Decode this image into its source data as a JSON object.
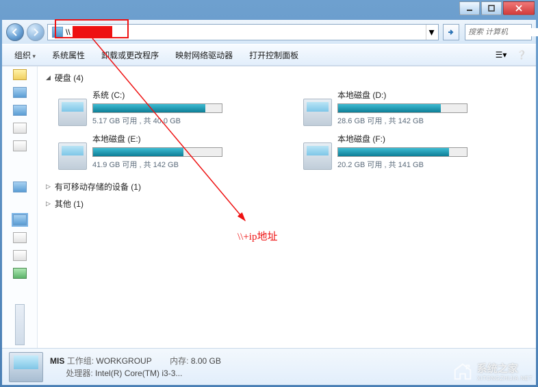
{
  "window": {
    "title": ""
  },
  "nav": {
    "address_value": "\\\\",
    "search_placeholder": "搜索 计算机"
  },
  "toolbar": {
    "organize": "组织",
    "sys_props": "系统属性",
    "uninstall": "卸载或更改程序",
    "map_drive": "映射网络驱动器",
    "control_panel": "打开控制面板"
  },
  "sections": {
    "drives": {
      "label": "硬盘",
      "count": "(4)"
    },
    "removable": {
      "label": "有可移动存储的设备",
      "count": "(1)"
    },
    "other": {
      "label": "其他",
      "count": "(1)"
    }
  },
  "drives": [
    {
      "name": "系统 (C:)",
      "free": "5.17 GB 可用 , 共 40.0 GB",
      "pct": 87
    },
    {
      "name": "本地磁盘 (D:)",
      "free": "28.6 GB 可用 , 共 142 GB",
      "pct": 80
    },
    {
      "name": "本地磁盘 (E:)",
      "free": "41.9 GB 可用 , 共 142 GB",
      "pct": 70
    },
    {
      "name": "本地磁盘 (F:)",
      "free": "20.2 GB 可用 , 共 141 GB",
      "pct": 86
    }
  ],
  "details": {
    "name": "MIS",
    "workgroup_label": "工作组:",
    "workgroup_value": "WORKGROUP",
    "mem_label": "内存:",
    "mem_value": "8.00 GB",
    "cpu_label": "处理器:",
    "cpu_value": "Intel(R) Core(TM) i3-3..."
  },
  "annotation": {
    "label": "\\\\+ip地址"
  },
  "watermark": {
    "text": "系统之家",
    "sub": "XITONGZHIJIA.NET"
  }
}
